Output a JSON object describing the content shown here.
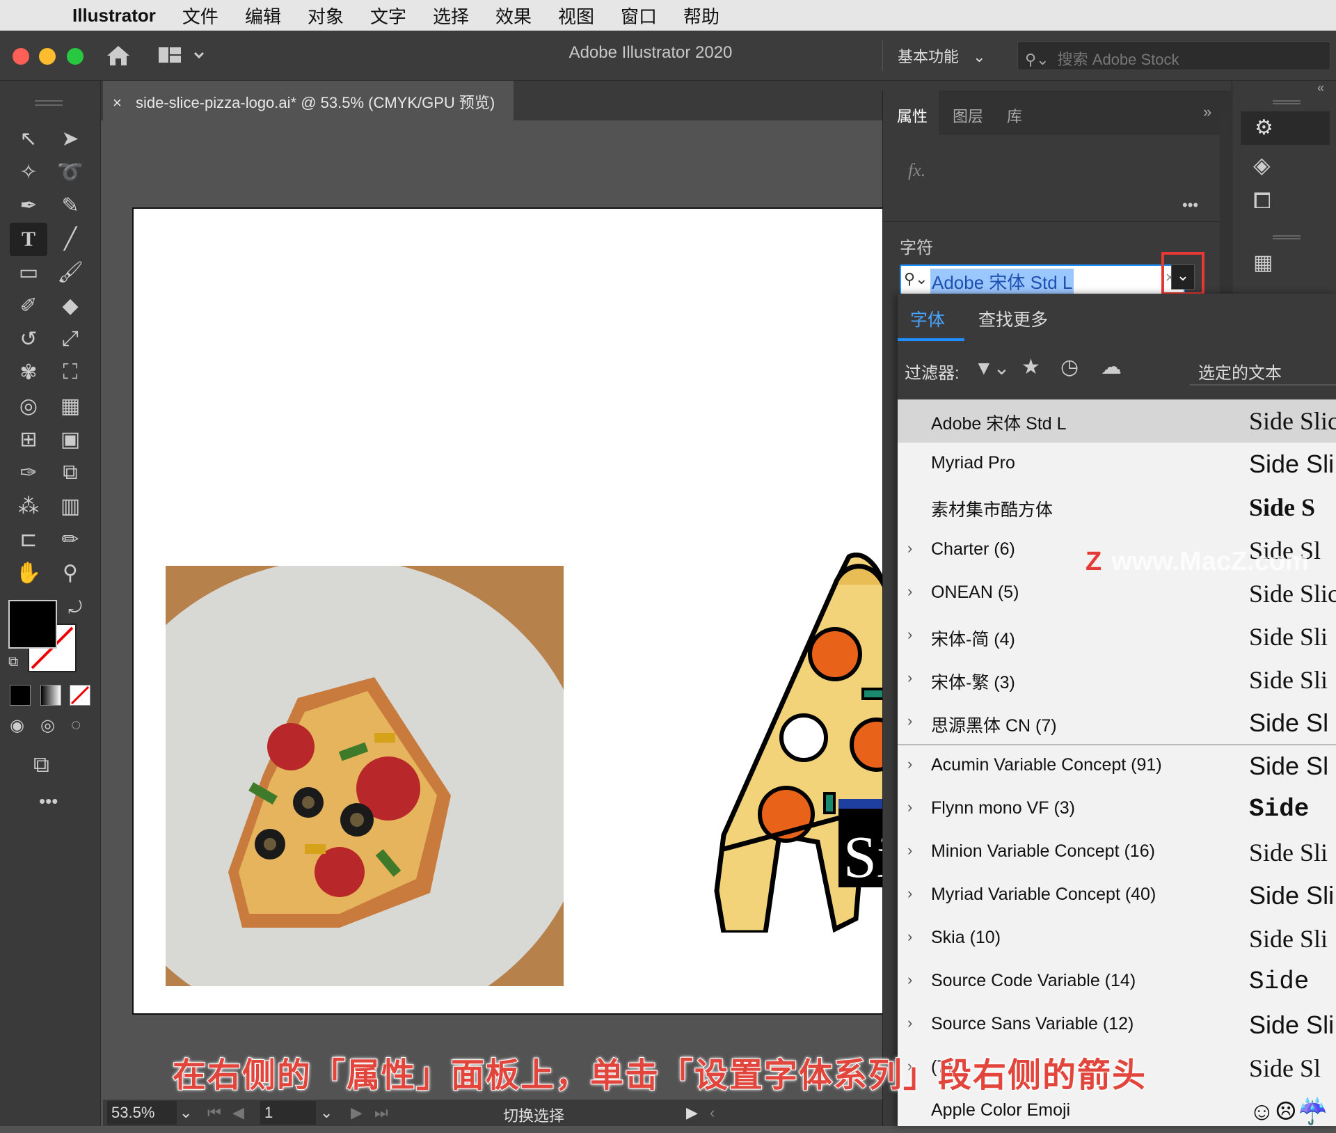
{
  "menubar": {
    "app": "Illustrator",
    "items": [
      "文件",
      "编辑",
      "对象",
      "文字",
      "选择",
      "效果",
      "视图",
      "窗口",
      "帮助"
    ]
  },
  "titlebar": {
    "title": "Adobe Illustrator 2020",
    "workspace": "基本功能",
    "stock_placeholder": "搜索 Adobe Stock"
  },
  "document_tab": {
    "close": "×",
    "label": "side-slice-pizza-logo.ai* @ 53.5% (CMYK/GPU 预览)"
  },
  "status": {
    "zoom": "53.5%",
    "page": "1",
    "mode": "切换选择"
  },
  "panel": {
    "tabs": [
      "属性",
      "图层",
      "库"
    ],
    "fx": "fx.",
    "more": "•••",
    "character_label": "字符",
    "font_value": "Adobe 宋体 Std L"
  },
  "font_menu": {
    "tabs": [
      "字体",
      "查找更多"
    ],
    "filter_label": "过滤器:",
    "selected_text_label": "选定的文本",
    "fonts": [
      {
        "name": "Adobe 宋体 Std L",
        "expandable": false,
        "selected": true,
        "preview": "Side Slic"
      },
      {
        "name": "Myriad Pro",
        "expandable": false,
        "selected": false,
        "preview": "Side Sli"
      },
      {
        "name": "素材集市酷方体",
        "expandable": false,
        "selected": false,
        "preview": "Side S"
      },
      {
        "name": "Charter (6)",
        "expandable": true,
        "selected": false,
        "preview": "Side Sl"
      },
      {
        "name": "ONEAN (5)",
        "expandable": true,
        "selected": false,
        "preview": "Side Slic"
      },
      {
        "name": "宋体-简 (4)",
        "expandable": true,
        "selected": false,
        "preview": "Side Sli"
      },
      {
        "name": "宋体-繁 (3)",
        "expandable": true,
        "selected": false,
        "preview": "Side Sli"
      },
      {
        "name": "思源黑体 CN (7)",
        "expandable": true,
        "selected": false,
        "preview": "Side Sl"
      },
      {
        "name": "Acumin Variable Concept (91)",
        "expandable": true,
        "selected": false,
        "preview": "Side Sl"
      },
      {
        "name": "Flynn mono VF (3)",
        "expandable": true,
        "selected": false,
        "preview": "Side"
      },
      {
        "name": "Minion Variable Concept (16)",
        "expandable": true,
        "selected": false,
        "preview": "Side Sli"
      },
      {
        "name": "Myriad Variable Concept (40)",
        "expandable": true,
        "selected": false,
        "preview": "Side Sli"
      },
      {
        "name": "Skia (10)",
        "expandable": true,
        "selected": false,
        "preview": "Side Sli"
      },
      {
        "name": "Source Code Variable (14)",
        "expandable": true,
        "selected": false,
        "preview": "Side"
      },
      {
        "name": "Source Sans Variable (12)",
        "expandable": true,
        "selected": false,
        "preview": "Side Sli"
      },
      {
        "name": "(7)",
        "expandable": true,
        "selected": false,
        "preview": "Side Sl"
      },
      {
        "name": "Apple Color Emoji",
        "expandable": false,
        "selected": false,
        "preview": "☺☹☔"
      }
    ]
  },
  "caption": "在右侧的「属性」面板上，单击「设置字体系列」段右侧的箭头",
  "watermark": "www.MacZ.com",
  "watermark_mark": "Z",
  "logo_text": "Si",
  "colors": {
    "accent": "#1f8fff",
    "highlight_box": "#e53935",
    "caption_red": "#e2453c"
  }
}
